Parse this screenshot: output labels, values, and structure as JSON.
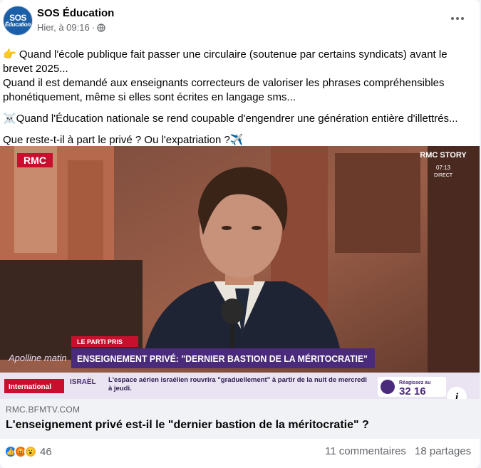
{
  "post": {
    "avatar_line1": "SOS",
    "avatar_line2": "Éducation",
    "page_name": "SOS Éducation",
    "time": "Hier, à 09:16",
    "separator": "·",
    "audience_icon": "globe-icon",
    "more_icon": "more-options-icon",
    "paragraph1": "👉 Quand l'école publique fait passer une circulaire (soutenue par certains syndicats) avant le brevet 2025...",
    "paragraph2": "Quand il est demandé aux enseignants correcteurs de valoriser les phrases compréhensibles phonétiquement, même si elles sont écrites en langage sms...",
    "paragraph3": "☠️Quand l'Éducation nationale se rend coupable d'engendrer une génération entière d'illettrés...",
    "paragraph4": "Que reste-t-il à part le privé ? Ou l'expatriation ?✈️"
  },
  "media": {
    "channel_logo": "RMC",
    "story_logo": "RMC STORY",
    "clock": "07:13",
    "live": "DIRECT",
    "section": "LE PARTI PRIS",
    "headline": "ENSEIGNEMENT PRIVÉ: \"DERNIER BASTION DE LA MÉRITOCRATIE\"",
    "show_name": "Apolline matin",
    "ticker_category": "International",
    "ticker_country": "ISRAËL",
    "ticker_text": "L'espace aérien israélien rouvrira \"graduellement\" à partir de la nuit de mercredi à jeudi.",
    "react_text": "Réagissez au",
    "react_number": "32 16",
    "info_icon": "i"
  },
  "link": {
    "domain": "RMC.BFMTV.COM",
    "title": "L'enseignement privé est-il le \"dernier bastion de la méritocratie\" ?"
  },
  "stats": {
    "reactions": [
      "like",
      "angry",
      "wow"
    ],
    "reaction_count": "46",
    "comments": "11 commentaires",
    "shares": "18 partages"
  },
  "colors": {
    "accent": "#1877f2",
    "secondary_text": "#65676b",
    "banner_red": "#c8102e",
    "banner_purple": "#4a2a7a"
  }
}
